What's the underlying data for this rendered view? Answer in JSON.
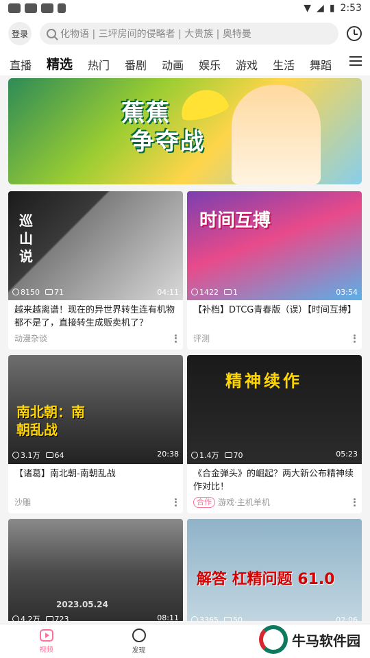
{
  "status": {
    "time": "2:53"
  },
  "header": {
    "login_label": "登录",
    "search_placeholder": "化物语 | 三坪房间的侵略者 | 大贵族 | 奥特曼"
  },
  "tabs": [
    {
      "label": "直播"
    },
    {
      "label": "精选",
      "active": true
    },
    {
      "label": "热门"
    },
    {
      "label": "番剧"
    },
    {
      "label": "动画"
    },
    {
      "label": "娱乐"
    },
    {
      "label": "游戏"
    },
    {
      "label": "生活"
    },
    {
      "label": "舞蹈"
    }
  ],
  "banner": {
    "title_line1": "蕉蕉",
    "title_line2": "争夺战"
  },
  "videos": [
    {
      "views": "8150",
      "danmaku": "71",
      "duration": "04:11",
      "title": "越来越离谱！现在的异世界转生连有机物都不是了，直接转生成贩卖机了？",
      "category": "动漫杂谈",
      "tag": "",
      "overlay": "巡山说"
    },
    {
      "views": "1422",
      "danmaku": "1",
      "duration": "03:54",
      "title": "【补档】DTCG青春版（误）【时间互搏】",
      "category": "评测",
      "tag": "",
      "overlay": "时间互搏"
    },
    {
      "views": "3.1万",
      "danmaku": "64",
      "duration": "20:38",
      "title": "【诸葛】南北朝-南朝乱战",
      "category": "沙雕",
      "tag": "",
      "overlay": "南北朝：南朝乱战"
    },
    {
      "views": "1.4万",
      "danmaku": "70",
      "duration": "05:23",
      "title": "《合金弹头》的崛起？两大新公布精神续作对比！",
      "category": "游戏·主机单机",
      "tag": "合作",
      "overlay": "精神续作"
    },
    {
      "views": "4.2万",
      "danmaku": "723",
      "duration": "08:11",
      "title": "",
      "category": "",
      "tag": "",
      "overlay": "2023.05.24"
    },
    {
      "views": "3365",
      "danmaku": "50",
      "duration": "02:06",
      "title": "",
      "category": "",
      "tag": "",
      "overlay": "解答 杠精问题 61.0"
    }
  ],
  "bottom_nav": [
    {
      "label": "视频",
      "active": true
    },
    {
      "label": "发现"
    }
  ],
  "watermark": "牛马软件园",
  "colors": {
    "accent": "#fb7299",
    "brand_green": "#0d7a5f"
  }
}
